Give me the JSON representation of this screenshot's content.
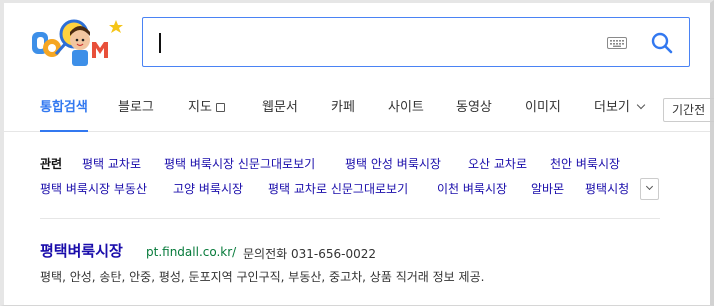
{
  "colors": {
    "accent": "#3278f0",
    "link": "#1a0dab",
    "url": "#067a3a"
  },
  "search": {
    "value": ""
  },
  "tabs": [
    {
      "label": "통합검색",
      "active": true
    },
    {
      "label": "블로그"
    },
    {
      "label": "지도"
    },
    {
      "label": "웹문서"
    },
    {
      "label": "카페"
    },
    {
      "label": "사이트"
    },
    {
      "label": "동영상"
    },
    {
      "label": "이미지"
    },
    {
      "label": "더보기"
    }
  ],
  "period_label": "기간전",
  "related": {
    "label": "관련",
    "items": [
      "평택 교차로",
      "평택 벼룩시장 신문그대로보기",
      "평택 안성 벼룩시장",
      "오산 교차로",
      "천안 벼룩시장",
      "평택 벼룩시장 부동산",
      "고양 벼룩시장",
      "평택 교차로 신문그대로보기",
      "이천 벼룩시장",
      "알바몬",
      "평택시청"
    ]
  },
  "result": {
    "title": "평택벼룩시장",
    "url": "pt.findall.co.kr/",
    "phone": "문의전화 031-656-0022",
    "description": "평택, 안성, 송탄, 안중, 평성, 둔포지역 구인구직, 부동산, 중고차, 상품 직거래 정보 제공."
  }
}
